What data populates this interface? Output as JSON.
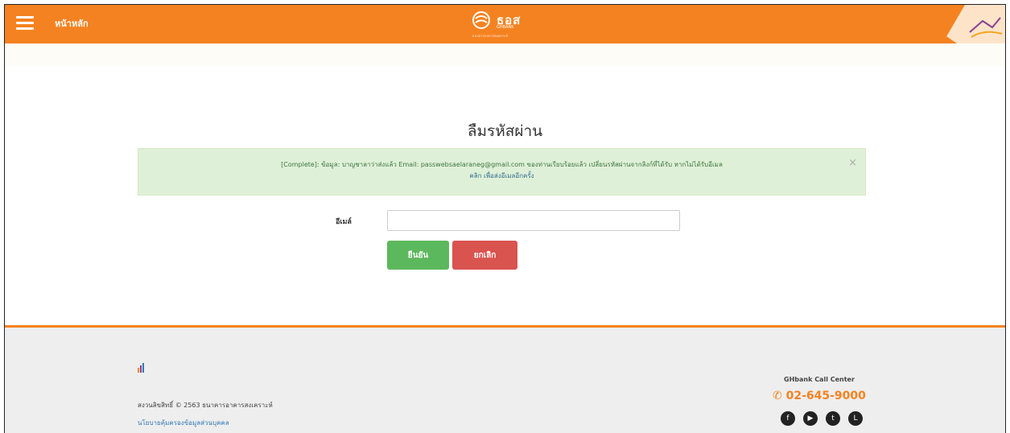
{
  "header": {
    "menu_icon": "hamburger-icon",
    "home_label": "หน้าหลัก",
    "brand_name": "ธอส",
    "brand_sub": "GHBANK",
    "brand_tagline": "ธนาคารอาคารสงเคราะห์",
    "accent_color": "#f58220"
  },
  "main": {
    "title": "ลืมรหัสผ่าน",
    "alert": {
      "message": "[Complete]: ข้อมูล: บาญชาลาว่าส่งแล้ว Email: passwebsaelaraneg@gmail.com ของท่านเรียบร้อยแล้ว เปลี่ยนรหัสผ่านจากลิงก์ที่ได้รับ หากไม่ได้รับอีเมล",
      "link_text": "คลิก เพื่อส่งอีเมลอีกครั้ง",
      "close_label": "×",
      "bg_color": "#dff0d8"
    },
    "email_label": "อีเมล์",
    "email_value": "",
    "confirm_label": "ยืนยัน",
    "cancel_label": "ยกเลิก",
    "confirm_color": "#5cb85c",
    "cancel_color": "#d9534f"
  },
  "footer": {
    "chart_icon": "bar-chart-icon",
    "copyright": "สงวนลิขสิทธิ์ © 2563 ธนาคารอาคารสงเคราะห์",
    "policy_link": "นโยบายคุ้มครองข้อมูลส่วนบุคคล",
    "call_center_title": "GHbank Call Center",
    "phone": "02-645-9000",
    "phone_icon": "phone-icon",
    "socials": [
      {
        "name": "facebook-icon",
        "glyph": "f"
      },
      {
        "name": "youtube-icon",
        "glyph": "▶"
      },
      {
        "name": "twitter-icon",
        "glyph": "t"
      },
      {
        "name": "line-icon",
        "glyph": "L"
      }
    ]
  }
}
